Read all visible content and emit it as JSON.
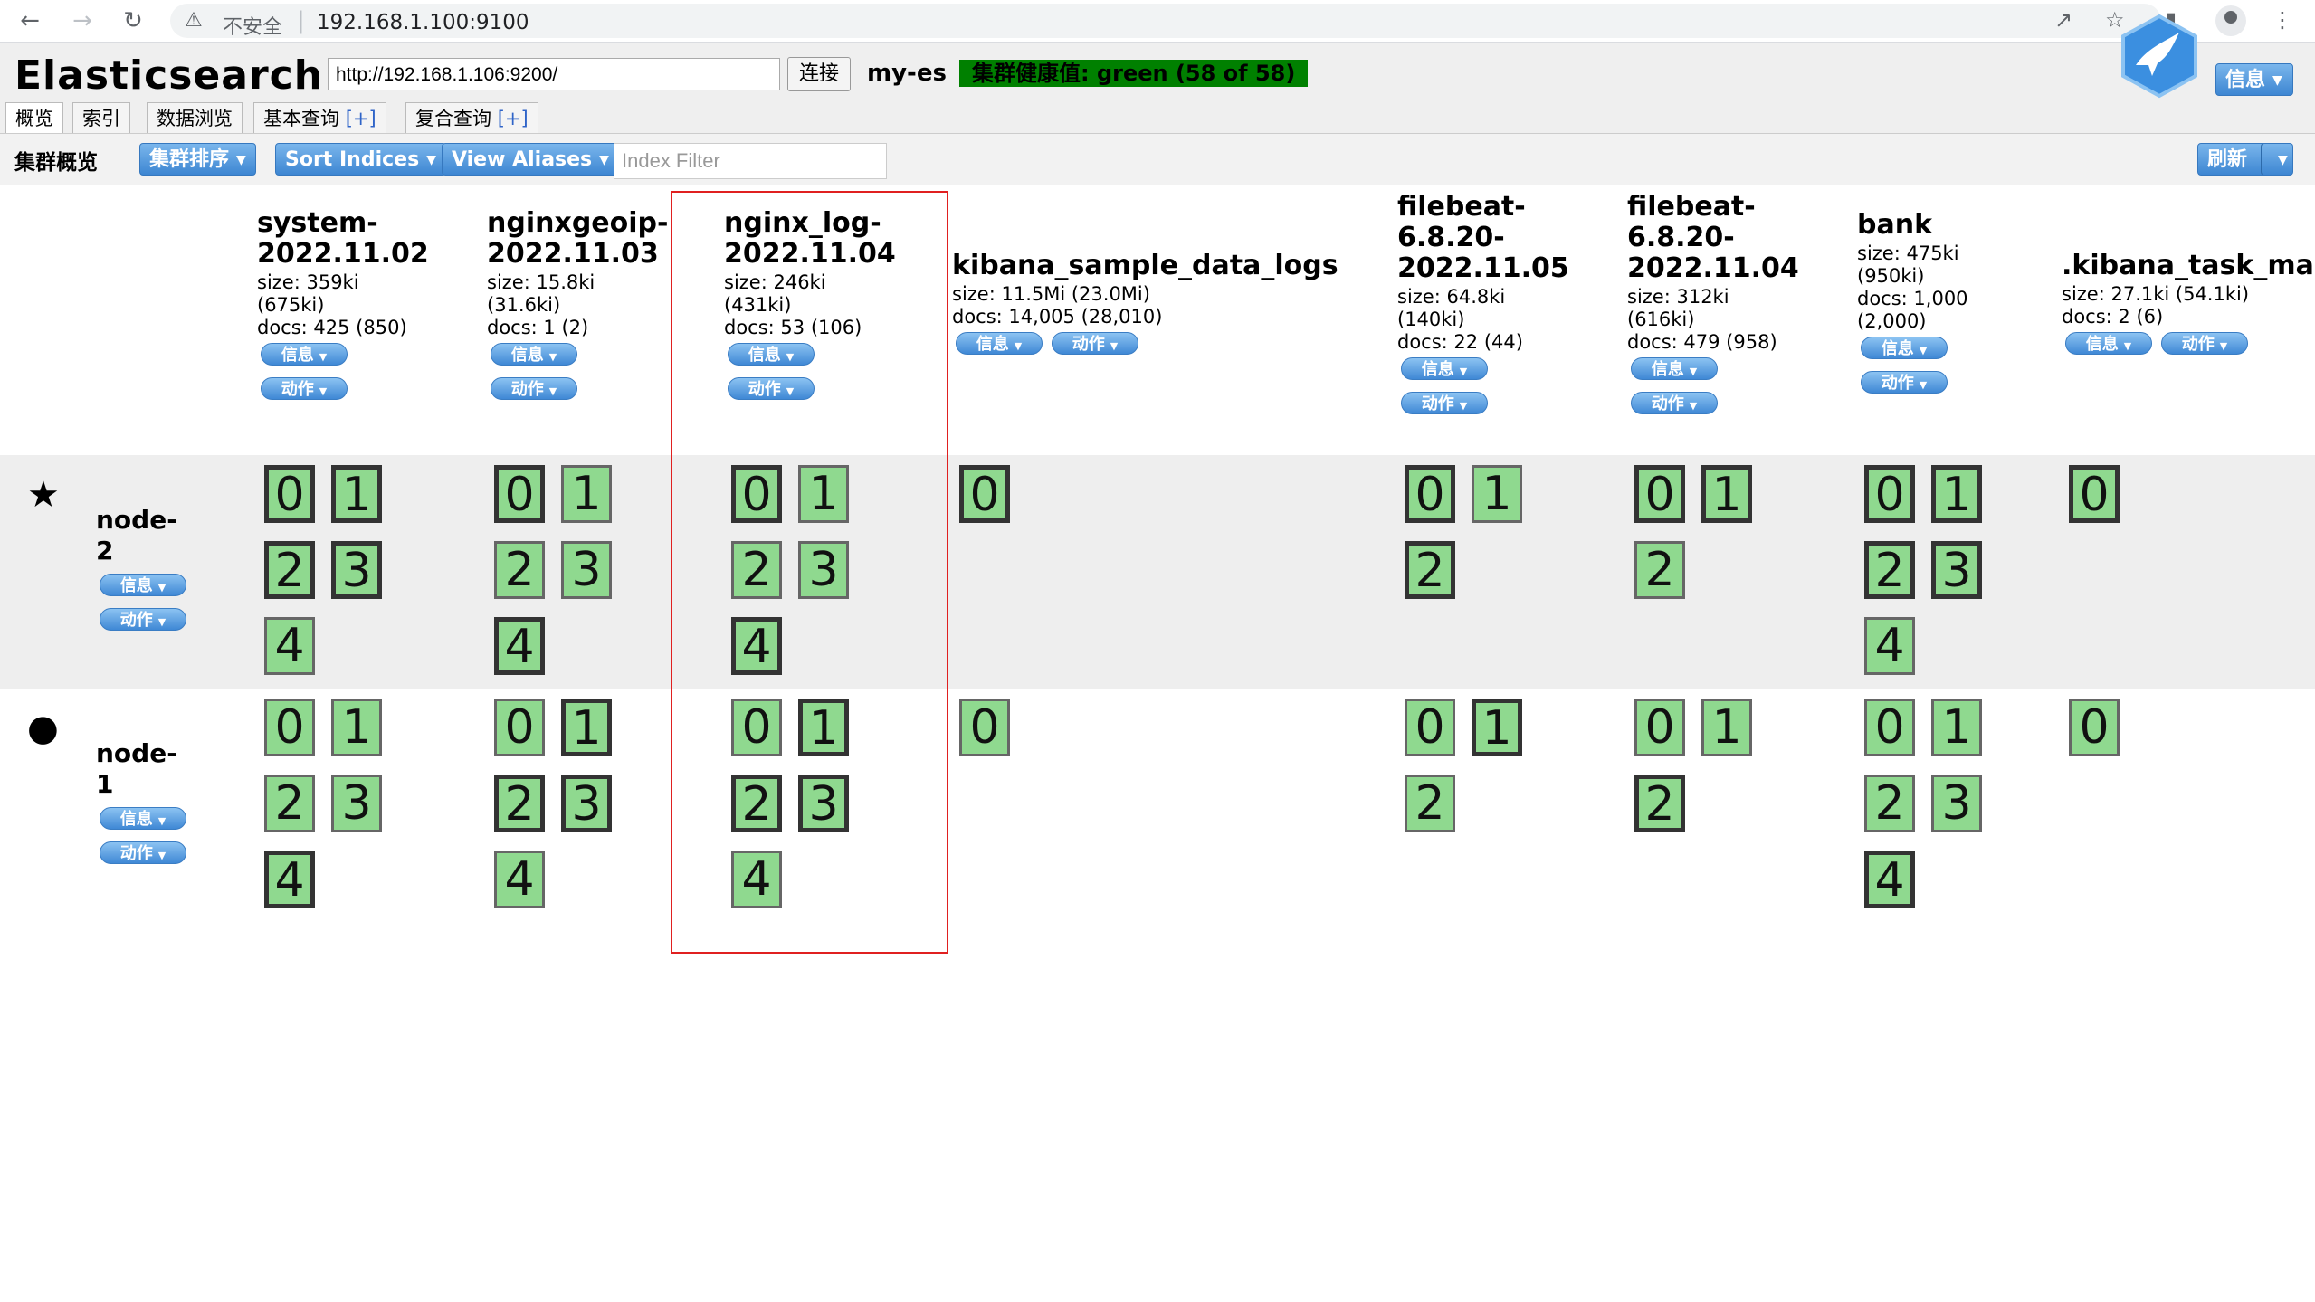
{
  "browser": {
    "security_label": "不安全",
    "url": "192.168.1.100:9100"
  },
  "header": {
    "title": "Elasticsearch",
    "connection_url": "http://192.168.1.106:9200/",
    "connect_label": "连接",
    "cluster_name": "my-es",
    "health": "集群健康值: green (58 of 58)",
    "info_label": "信息"
  },
  "tabs": [
    {
      "label": "概览"
    },
    {
      "label": "索引"
    },
    {
      "label": "数据浏览"
    },
    {
      "label": "基本查询",
      "plus": "[+]"
    },
    {
      "label": "复合查询",
      "plus": "[+]"
    }
  ],
  "toolbar": {
    "title": "集群概览",
    "cluster_sort": "集群排序",
    "sort_indices": "Sort Indices",
    "view_aliases": "View Aliases",
    "filter_placeholder": "Index Filter",
    "refresh": "刷新"
  },
  "pill_labels": {
    "info": "信息",
    "action": "动作"
  },
  "colors": {
    "health_green": "#008000",
    "shard_green": "#8fd98f",
    "highlight": "#e02020",
    "button_blue": "#3d86d2"
  },
  "indices": [
    {
      "name_lines": [
        "system-",
        "2022.11.02"
      ],
      "meta_lines": [
        "size: 359ki",
        "(675ki)",
        "docs: 425 (850)"
      ]
    },
    {
      "name_lines": [
        "nginxgeoip-",
        "2022.11.03"
      ],
      "meta_lines": [
        "size: 15.8ki",
        "(31.6ki)",
        "docs: 1 (2)"
      ]
    },
    {
      "name_lines": [
        "nginx_log-",
        "2022.11.04"
      ],
      "meta_lines": [
        "size: 246ki",
        "(431ki)",
        "docs: 53 (106)"
      ]
    },
    {
      "name_lines": [
        "kibana_sample_data_logs"
      ],
      "meta_lines": [
        "size: 11.5Mi (23.0Mi)",
        "docs: 14,005 (28,010)"
      ]
    },
    {
      "name_lines": [
        "filebeat-",
        "6.8.20-",
        "2022.11.05"
      ],
      "meta_lines": [
        "size: 64.8ki",
        "(140ki)",
        "docs: 22 (44)"
      ]
    },
    {
      "name_lines": [
        "filebeat-",
        "6.8.20-",
        "2022.11.04"
      ],
      "meta_lines": [
        "size: 312ki",
        "(616ki)",
        "docs: 479 (958)"
      ]
    },
    {
      "name_lines": [
        "bank"
      ],
      "meta_lines": [
        "size: 475ki",
        "(950ki)",
        "docs: 1,000",
        "(2,000)"
      ]
    },
    {
      "name_lines": [
        ".kibana_task_ma"
      ],
      "meta_lines": [
        "size: 27.1ki (54.1ki)",
        "docs: 2 (6)"
      ]
    }
  ],
  "nodes": [
    {
      "icon": "star-icon",
      "name_lines": [
        "node-",
        "2"
      ],
      "shards": [
        [
          {
            "n": "0",
            "p": true
          },
          {
            "n": "1",
            "p": true
          },
          {
            "n": "2",
            "p": true
          },
          {
            "n": "3",
            "p": true
          },
          {
            "n": "4",
            "p": false
          }
        ],
        [
          {
            "n": "0",
            "p": true
          },
          {
            "n": "1",
            "p": false
          },
          {
            "n": "2",
            "p": false
          },
          {
            "n": "3",
            "p": false
          },
          {
            "n": "4",
            "p": true
          }
        ],
        [
          {
            "n": "0",
            "p": true
          },
          {
            "n": "1",
            "p": false
          },
          {
            "n": "2",
            "p": false
          },
          {
            "n": "3",
            "p": false
          },
          {
            "n": "4",
            "p": true
          }
        ],
        [
          {
            "n": "0",
            "p": true
          }
        ],
        [
          {
            "n": "0",
            "p": true
          },
          {
            "n": "1",
            "p": false
          },
          {
            "n": "2",
            "p": true
          }
        ],
        [
          {
            "n": "0",
            "p": true
          },
          {
            "n": "1",
            "p": true
          },
          {
            "n": "2",
            "p": false
          }
        ],
        [
          {
            "n": "0",
            "p": true
          },
          {
            "n": "1",
            "p": true
          },
          {
            "n": "2",
            "p": true
          },
          {
            "n": "3",
            "p": true
          },
          {
            "n": "4",
            "p": false
          }
        ],
        [
          {
            "n": "0",
            "p": true
          }
        ]
      ]
    },
    {
      "icon": "circle-icon",
      "name_lines": [
        "node-",
        "1"
      ],
      "shards": [
        [
          {
            "n": "0",
            "p": false
          },
          {
            "n": "1",
            "p": false
          },
          {
            "n": "2",
            "p": false
          },
          {
            "n": "3",
            "p": false
          },
          {
            "n": "4",
            "p": true
          }
        ],
        [
          {
            "n": "0",
            "p": false
          },
          {
            "n": "1",
            "p": true
          },
          {
            "n": "2",
            "p": true
          },
          {
            "n": "3",
            "p": true
          },
          {
            "n": "4",
            "p": false
          }
        ],
        [
          {
            "n": "0",
            "p": false
          },
          {
            "n": "1",
            "p": true
          },
          {
            "n": "2",
            "p": true
          },
          {
            "n": "3",
            "p": true
          },
          {
            "n": "4",
            "p": false
          }
        ],
        [
          {
            "n": "0",
            "p": false
          }
        ],
        [
          {
            "n": "0",
            "p": false
          },
          {
            "n": "1",
            "p": true
          },
          {
            "n": "2",
            "p": false
          }
        ],
        [
          {
            "n": "0",
            "p": false
          },
          {
            "n": "1",
            "p": false
          },
          {
            "n": "2",
            "p": true
          }
        ],
        [
          {
            "n": "0",
            "p": false
          },
          {
            "n": "1",
            "p": false
          },
          {
            "n": "2",
            "p": false
          },
          {
            "n": "3",
            "p": false
          },
          {
            "n": "4",
            "p": true
          }
        ],
        [
          {
            "n": "0",
            "p": false
          }
        ]
      ]
    }
  ]
}
